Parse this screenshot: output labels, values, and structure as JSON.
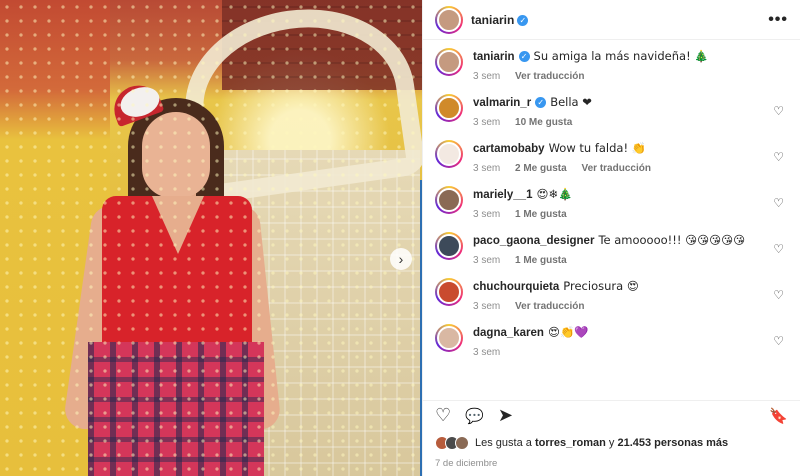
{
  "header": {
    "username": "taniarin",
    "more_label": "•••"
  },
  "post_caption": {
    "username": "taniarin",
    "text": "Su amiga la más navideña! 🎄",
    "time": "3 sem",
    "translate": "Ver traducción"
  },
  "comments": [
    {
      "username": "valmarin_r",
      "verified": true,
      "text": "Bella ❤",
      "time": "3 sem",
      "likes": "10 Me gusta",
      "translate": "",
      "avatar_color": "#d08a2a"
    },
    {
      "username": "cartamobaby",
      "verified": false,
      "text": "Wow tu falda! 👏",
      "time": "3 sem",
      "likes": "2 Me gusta",
      "translate": "Ver traducción",
      "avatar_color": "#f3e9e2"
    },
    {
      "username": "mariely__1",
      "verified": false,
      "text": "😍❄🎄",
      "time": "3 sem",
      "likes": "1 Me gusta",
      "translate": "",
      "avatar_color": "#8a6a55"
    },
    {
      "username": "paco_gaona_designer",
      "verified": false,
      "text": "Te amooooo!!! 😘😘😘😘😘",
      "time": "3 sem",
      "likes": "1 Me gusta",
      "translate": "",
      "avatar_color": "#3d4a5a"
    },
    {
      "username": "chuchourquieta",
      "verified": false,
      "text": "Preciosura 😍",
      "time": "3 sem",
      "likes": "",
      "translate": "Ver traducción",
      "avatar_color": "#c94b2f"
    },
    {
      "username": "dagna_karen",
      "verified": false,
      "text": "😍👏💜",
      "time": "3 sem",
      "likes": "",
      "translate": "",
      "avatar_color": "#d9b8a3"
    }
  ],
  "actions": {
    "like": "♡",
    "comment": "💬",
    "share": "➤",
    "save": "🔖"
  },
  "likes": {
    "prefix": "Les gusta a ",
    "user": "torres_roman",
    "middle": " y ",
    "count": "21.453 personas más"
  },
  "date": "7 de diciembre",
  "colors": {
    "verified": "#3897f0",
    "muted": "#8e8e8e",
    "heart": "#e0245e"
  }
}
